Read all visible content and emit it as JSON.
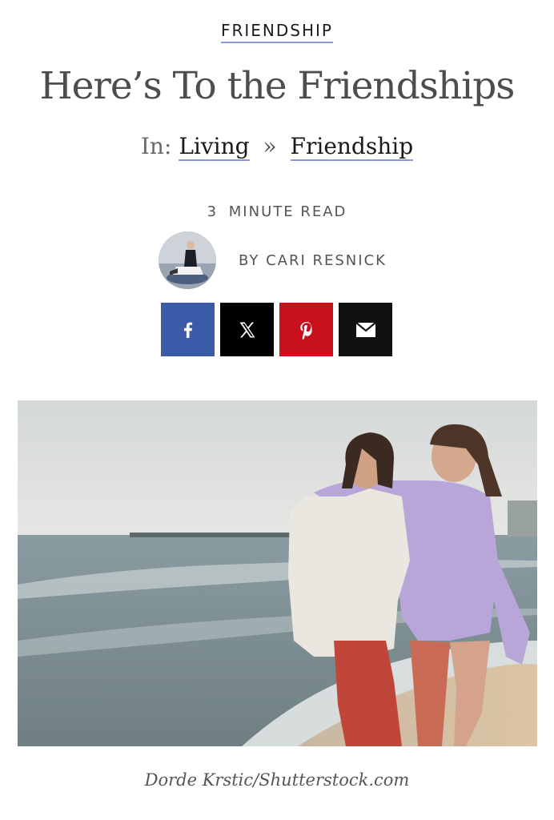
{
  "category": {
    "label": "FRIENDSHIP"
  },
  "article": {
    "title": "Here’s To the Friendships",
    "breadcrumb": {
      "prefix": "In:",
      "items": [
        "Living",
        "Friendship"
      ],
      "separator": "»"
    },
    "read_time": {
      "number": "3",
      "label": "MINUTE READ"
    },
    "author": {
      "byline": "BY CARI RESNICK"
    }
  },
  "share": {
    "buttons": [
      {
        "name": "facebook",
        "icon": "facebook-icon",
        "color": "#3b5ba9"
      },
      {
        "name": "x",
        "icon": "x-icon",
        "color": "#000000"
      },
      {
        "name": "pinterest",
        "icon": "pinterest-icon",
        "color": "#c8111d"
      },
      {
        "name": "email",
        "icon": "envelope-icon",
        "color": "#111111"
      }
    ]
  },
  "hero": {
    "caption": "Dorde Krstic/Shutterstock.com"
  },
  "colors": {
    "link_underline": "#8d9ad6",
    "title_text": "#4d4d4d"
  }
}
